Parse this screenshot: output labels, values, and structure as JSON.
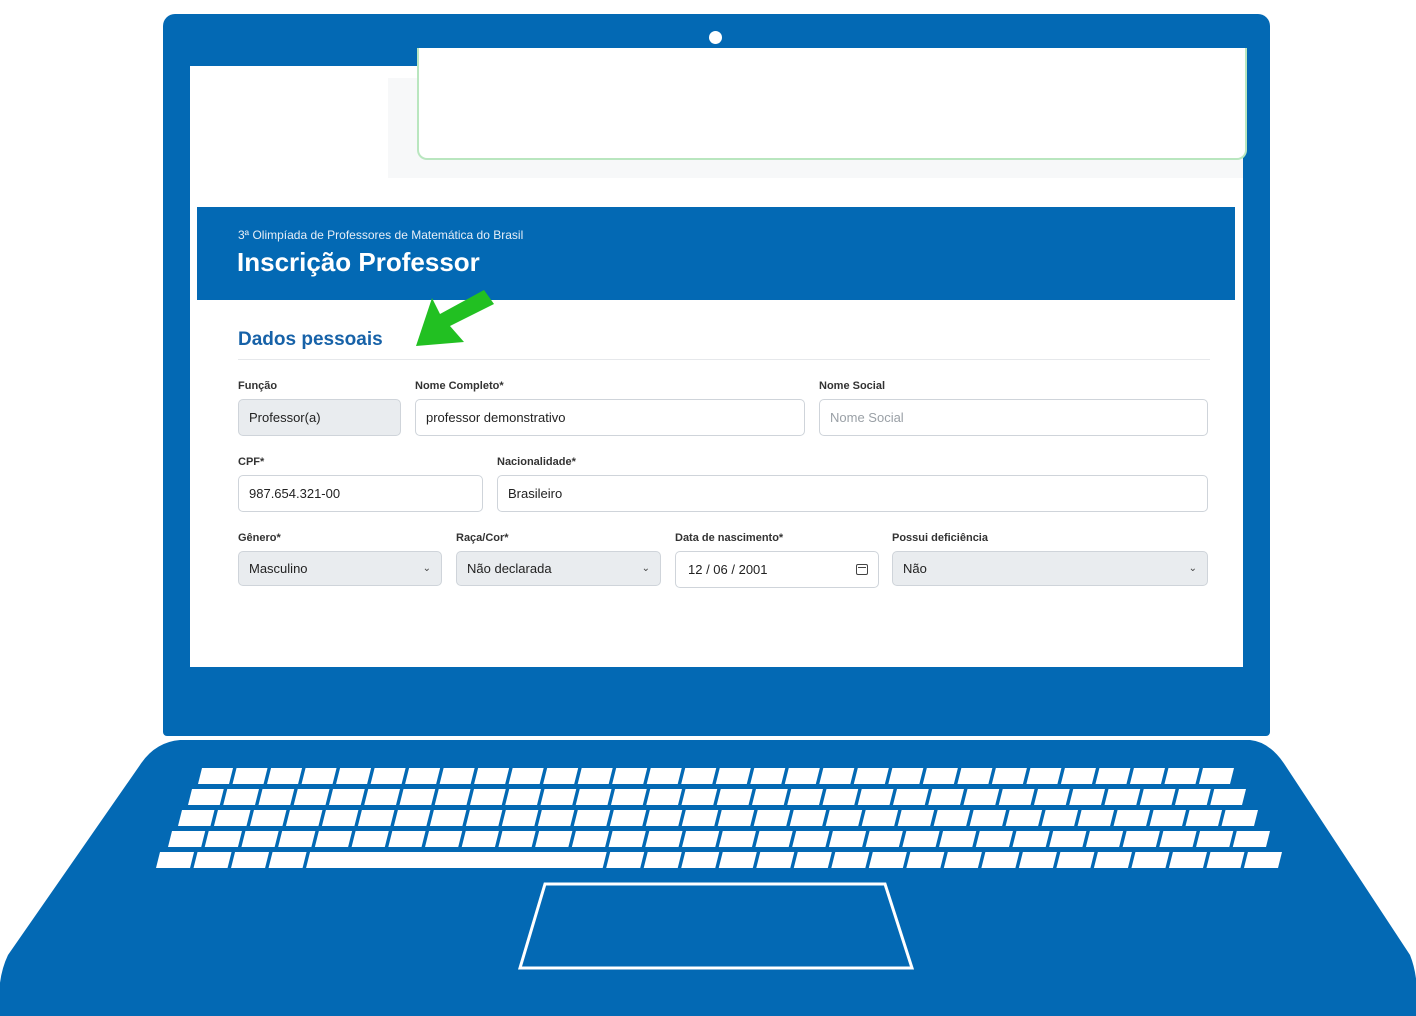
{
  "header": {
    "subtitle": "3ª Olimpíada de Professores de Matemática do Brasil",
    "title": "Inscrição Professor"
  },
  "section": {
    "title": "Dados pessoais"
  },
  "form": {
    "funcao": {
      "label": "Função",
      "value": "Professor(a)"
    },
    "nome_completo": {
      "label": "Nome Completo*",
      "value": "professor demonstrativo"
    },
    "nome_social": {
      "label": "Nome Social",
      "placeholder": "Nome Social"
    },
    "cpf": {
      "label": "CPF*",
      "value": "987.654.321-00"
    },
    "nacionalidade": {
      "label": "Nacionalidade*",
      "value": "Brasileiro"
    },
    "genero": {
      "label": "Gênero*",
      "value": "Masculino"
    },
    "raca_cor": {
      "label": "Raça/Cor*",
      "value": "Não declarada"
    },
    "data_nascimento": {
      "label": "Data de nascimento*",
      "value": "12 / 06 / 2001"
    },
    "deficiencia": {
      "label": "Possui deficiência",
      "value": "Não"
    }
  },
  "colors": {
    "brand_blue": "#0369b4",
    "section_title": "#1762a8",
    "arrow_green": "#22c022",
    "field_disabled": "#e9ecef"
  },
  "icons": {
    "arrow": "pointer-arrow-icon",
    "chevron": "chevron-down-icon",
    "calendar": "calendar-icon"
  }
}
